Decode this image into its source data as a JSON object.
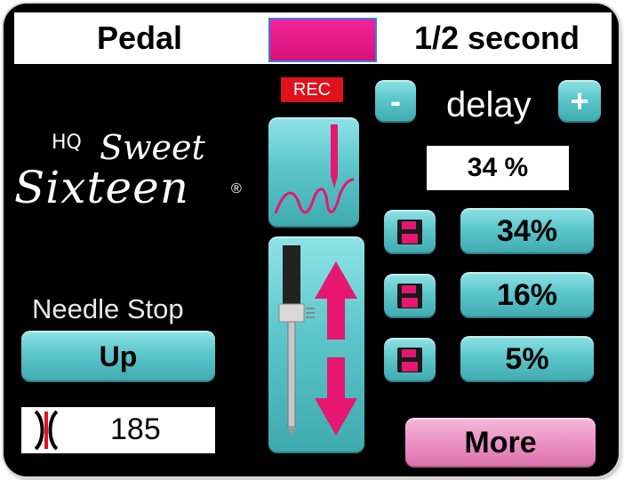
{
  "header": {
    "mode": "Pedal",
    "speed": "1/2 second",
    "swatch_color": "#ee1c8c"
  },
  "logo": {
    "brand_small": "HQ",
    "line1": "Sweet",
    "line2": "Sixteen",
    "mark": "®"
  },
  "left": {
    "needle_stop_label": "Needle Stop",
    "needle_stop_value": "Up",
    "stitch_count": "185",
    "stitch_icon": "stitch-bracket-icon"
  },
  "center": {
    "rec_label": "REC",
    "record_icon": "stitch-record-icon",
    "needle_icon": "needle-up-down-icon"
  },
  "right": {
    "minus": "-",
    "plus": "+",
    "delay_label": "delay",
    "delay_value": "34 %",
    "presets": [
      {
        "value": "34%",
        "icon": "floppy-disk-icon"
      },
      {
        "value": "16%",
        "icon": "floppy-disk-icon"
      },
      {
        "value": "5%",
        "icon": "floppy-disk-icon"
      }
    ],
    "more": "More"
  },
  "colors": {
    "teal": "#5cc6cb",
    "pink": "#e98bbf",
    "magenta": "#ee1c8c",
    "rec_red": "#e0121e"
  }
}
